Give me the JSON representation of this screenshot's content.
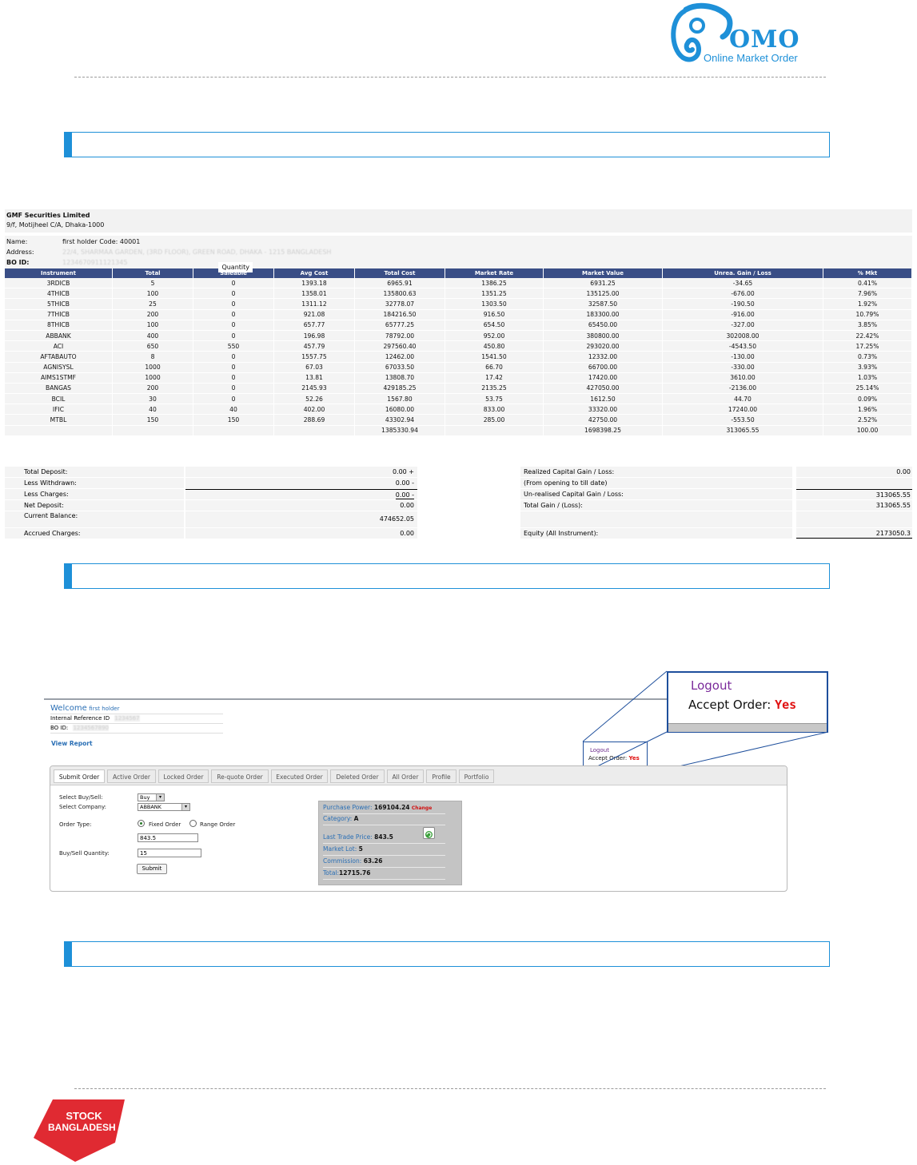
{
  "logo": {
    "text": "OMO",
    "tagline": "Online Market Order"
  },
  "report": {
    "company": "GMF Securities Limited",
    "company_address": "9/f, Motijheel C/A, Dhaka-1000",
    "name_label": "Name:",
    "name_value": "first holder Code: 40001",
    "address_label": "Address:",
    "address_value": "22/4, SHARMAA GARDEN, (3RD FLOOR), GREEN ROAD, DHAKA - 1215 BANGLADESH",
    "boid_label": "BO ID:",
    "boid_value": "1234670911121345",
    "quantity_label": "Quantity",
    "columns": [
      "Instrument",
      "Total",
      "Saleable",
      "Avg Cost",
      "Total Cost",
      "Market Rate",
      "Market Value",
      "Unrea. Gain / Loss",
      "% Mkt"
    ],
    "rows": [
      [
        "3RDICB",
        "5",
        "0",
        "1393.18",
        "6965.91",
        "1386.25",
        "6931.25",
        "-34.65",
        "0.41%"
      ],
      [
        "4THICB",
        "100",
        "0",
        "1358.01",
        "135800.63",
        "1351.25",
        "135125.00",
        "-676.00",
        "7.96%"
      ],
      [
        "5THICB",
        "25",
        "0",
        "1311.12",
        "32778.07",
        "1303.50",
        "32587.50",
        "-190.50",
        "1.92%"
      ],
      [
        "7THICB",
        "200",
        "0",
        "921.08",
        "184216.50",
        "916.50",
        "183300.00",
        "-916.00",
        "10.79%"
      ],
      [
        "8THICB",
        "100",
        "0",
        "657.77",
        "65777.25",
        "654.50",
        "65450.00",
        "-327.00",
        "3.85%"
      ],
      [
        "ABBANK",
        "400",
        "0",
        "196.98",
        "78792.00",
        "952.00",
        "380800.00",
        "302008.00",
        "22.42%"
      ],
      [
        "ACI",
        "650",
        "550",
        "457.79",
        "297560.40",
        "450.80",
        "293020.00",
        "-4543.50",
        "17.25%"
      ],
      [
        "AFTABAUTO",
        "8",
        "0",
        "1557.75",
        "12462.00",
        "1541.50",
        "12332.00",
        "-130.00",
        "0.73%"
      ],
      [
        "AGNISYSL",
        "1000",
        "0",
        "67.03",
        "67033.50",
        "66.70",
        "66700.00",
        "-330.00",
        "3.93%"
      ],
      [
        "AIMS1STMF",
        "1000",
        "0",
        "13.81",
        "13808.70",
        "17.42",
        "17420.00",
        "3610.00",
        "1.03%"
      ],
      [
        "BANGAS",
        "200",
        "0",
        "2145.93",
        "429185.25",
        "2135.25",
        "427050.00",
        "-2136.00",
        "25.14%"
      ],
      [
        "BCIL",
        "30",
        "0",
        "52.26",
        "1567.80",
        "53.75",
        "1612.50",
        "44.70",
        "0.09%"
      ],
      [
        "IFIC",
        "40",
        "40",
        "402.00",
        "16080.00",
        "833.00",
        "33320.00",
        "17240.00",
        "1.96%"
      ],
      [
        "MTBL",
        "150",
        "150",
        "288.69",
        "43302.94",
        "285.00",
        "42750.00",
        "-553.50",
        "2.52%"
      ]
    ],
    "totals": [
      "",
      "",
      "",
      "",
      "1385330.94",
      "",
      "1698398.25",
      "313065.55",
      "100.00"
    ]
  },
  "summary": {
    "left": [
      {
        "label": "Total Deposit:",
        "value": "0.00 +"
      },
      {
        "label": "Less Withdrawn:",
        "value": "0.00 -"
      },
      {
        "label": "Less Charges:",
        "value": "0.00 -"
      },
      {
        "label": "Net Deposit:",
        "value": "0.00"
      },
      {
        "label": "Current Balance:",
        "value": "474652.05"
      },
      {
        "label": "Accrued Charges:",
        "value": "0.00"
      }
    ],
    "right": [
      {
        "label": "Realized Capital Gain / Loss:",
        "value": "0.00"
      },
      {
        "label": "(From opening to till date)",
        "value": ""
      },
      {
        "label": "Un-realised Capital Gain / Loss:",
        "value": "313065.55"
      },
      {
        "label": "Total Gain / (Loss):",
        "value": "313065.55"
      },
      {
        "label": "Equity (All Instrument):",
        "value": "2173050.3"
      }
    ]
  },
  "trade": {
    "welcome": "Welcome",
    "user": "first holder",
    "ref_label": "Internal Reference ID",
    "ref_value": "1234567",
    "boid_label": "BO ID:",
    "boid_value": "1234567890",
    "view_report": "View Report",
    "logout": "Logout",
    "accept_label": "Accept Order:",
    "accept_value": "Yes",
    "tabs": [
      "Submit Order",
      "Active Order",
      "Locked Order",
      "Re-quote Order",
      "Executed Order",
      "Deleted Order",
      "All Order",
      "Profile",
      "Portfolio"
    ],
    "buy_sell_label": "Select Buy/Sell:",
    "buy_sell_value": "Buy",
    "company_label": "Select Company:",
    "company_value": "ABBANK",
    "order_type_label": "Order Type:",
    "fixed_order": "Fixed Order",
    "range_order": "Range Order",
    "price_value": "843.5",
    "qty_label": "Buy/Sell Quantity:",
    "qty_value": "15",
    "submit": "Submit",
    "purchase_power_label": "Purchase Power:",
    "purchase_power_value": "169104.24",
    "change": "Change",
    "category_label": "Category:",
    "category_value": "A",
    "ltp_label": "Last Trade Price:",
    "ltp_value": "843.5",
    "market_lot_label": "Market Lot:",
    "market_lot_value": "5",
    "commission_label": "Commission:",
    "commission_value": "63.26",
    "total_label": "Total:",
    "total_value": "12715.76"
  },
  "footer": {
    "brand_line1": "STOCK",
    "brand_line2": "BANGLADESH"
  },
  "colors": {
    "accent": "#1e90d8",
    "table_header": "#3a4e86",
    "brand_red": "#e02a32"
  }
}
